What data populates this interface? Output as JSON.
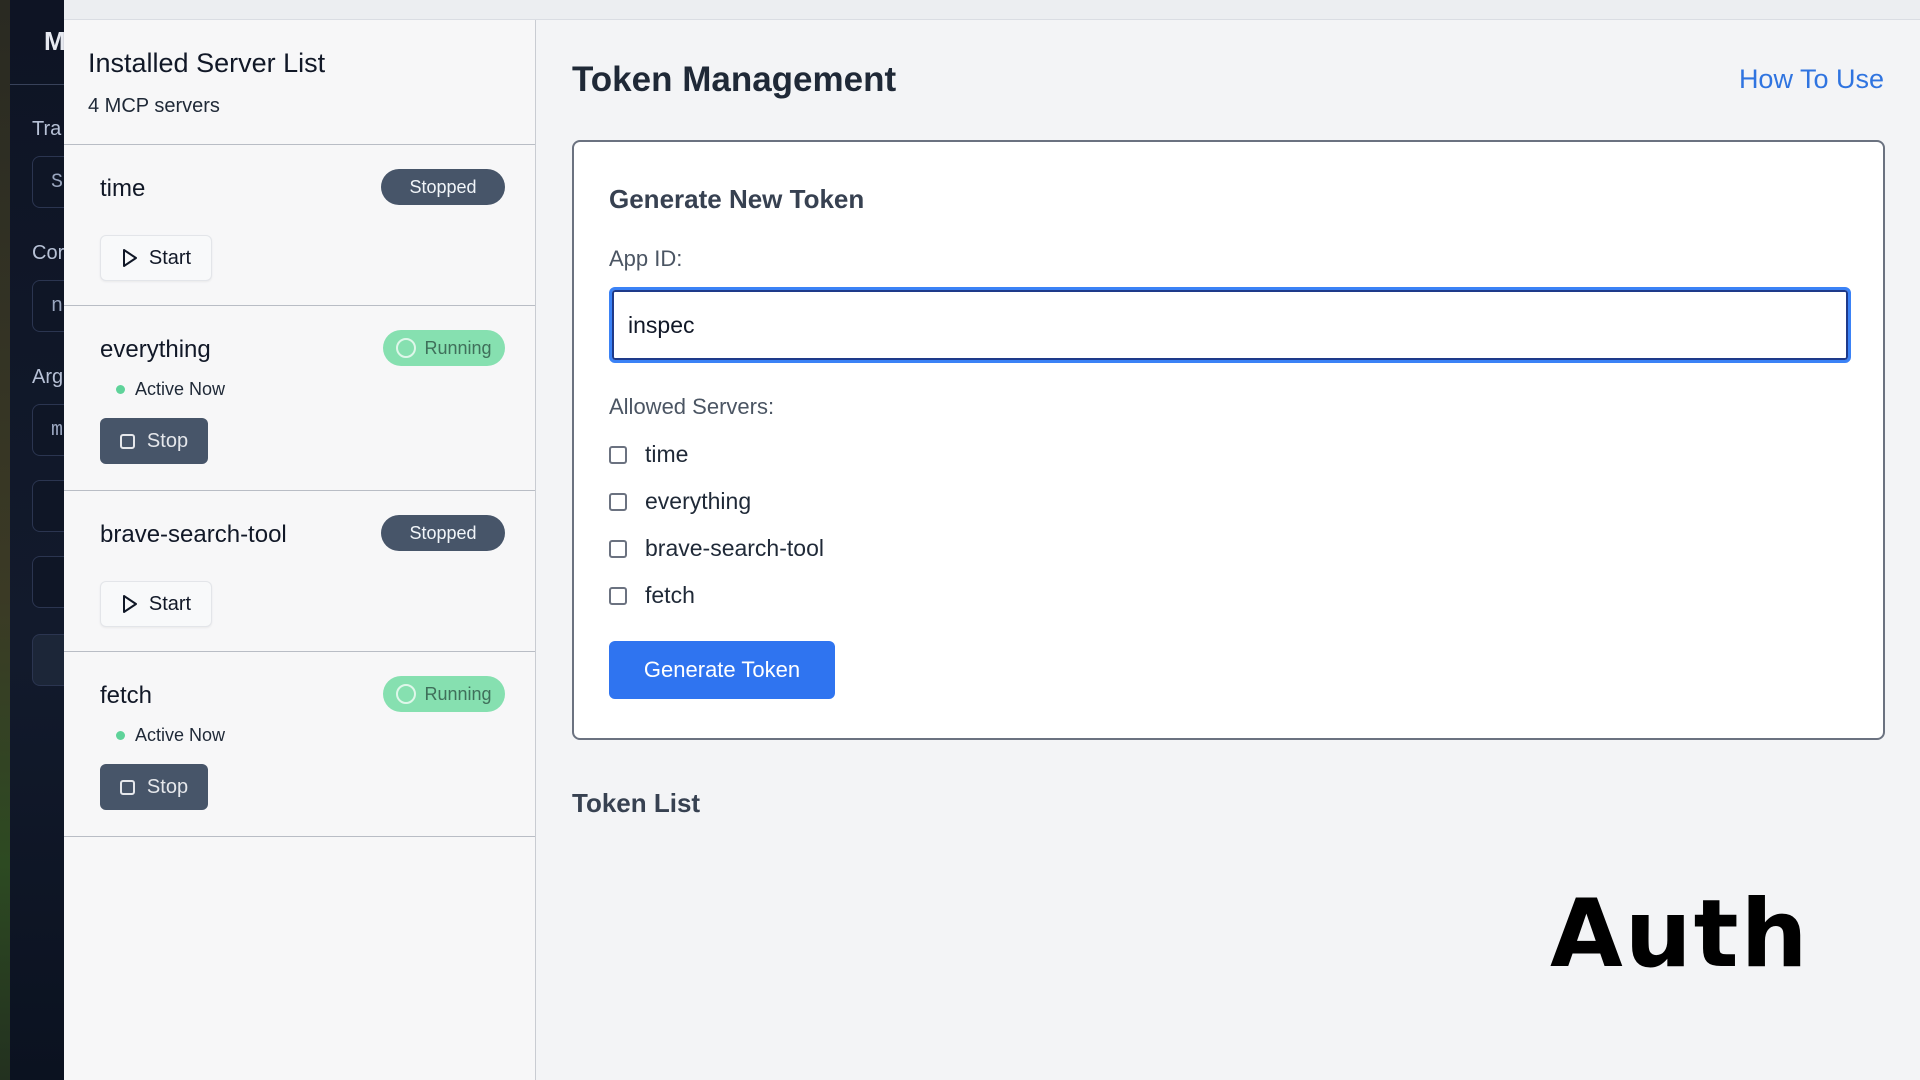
{
  "background_app": {
    "fragments": [
      "M",
      "Tra",
      "S",
      "Cor",
      "n",
      "Arg",
      "m"
    ]
  },
  "sidebar": {
    "title": "Installed Server List",
    "subtitle": "4 MCP servers",
    "servers": [
      {
        "name": "time",
        "status": "Stopped",
        "action": "Start",
        "active_text": ""
      },
      {
        "name": "everything",
        "status": "Running",
        "action": "Stop",
        "active_text": "Active Now"
      },
      {
        "name": "brave-search-tool",
        "status": "Stopped",
        "action": "Start",
        "active_text": ""
      },
      {
        "name": "fetch",
        "status": "Running",
        "action": "Stop",
        "active_text": "Active Now"
      }
    ]
  },
  "main": {
    "title": "Token Management",
    "help_link": "How To Use",
    "form": {
      "title": "Generate New Token",
      "app_id_label": "App ID:",
      "app_id_value": "inspec",
      "allowed_label": "Allowed Servers:",
      "servers": [
        "time",
        "everything",
        "brave-search-tool",
        "fetch"
      ],
      "submit_label": "Generate Token"
    },
    "token_list_title": "Token List"
  },
  "overlay_text": "Auth",
  "colors": {
    "accent": "#2f74f0",
    "link": "#2f74e0",
    "stopped_badge": "#475569",
    "running_badge": "#86e0b0",
    "active_dot": "#5fd39a"
  }
}
